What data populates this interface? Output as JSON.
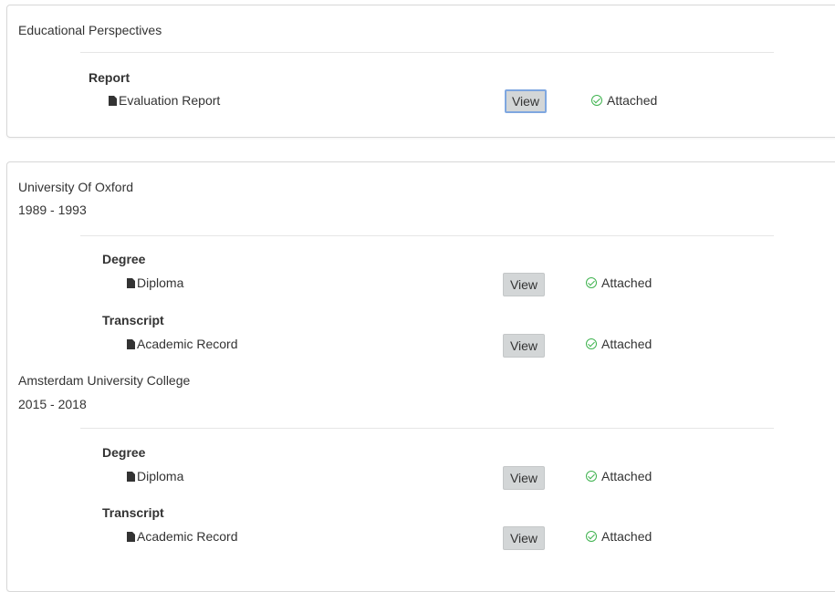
{
  "panel1": {
    "title": "Educational Perspectives",
    "section": {
      "heading": "Report",
      "document": "Evaluation Report",
      "view_label": "View",
      "status": "Attached"
    }
  },
  "institutions": [
    {
      "name": "University Of Oxford",
      "years": "1989 - 1993",
      "items": [
        {
          "heading": "Degree",
          "document": "Diploma",
          "view_label": "View",
          "status": "Attached"
        },
        {
          "heading": "Transcript",
          "document": "Academic Record",
          "view_label": "View",
          "status": "Attached"
        }
      ]
    },
    {
      "name": "Amsterdam University College",
      "years": "2015 - 2018",
      "items": [
        {
          "heading": "Degree",
          "document": "Diploma",
          "view_label": "View",
          "status": "Attached"
        },
        {
          "heading": "Transcript",
          "document": "Academic Record",
          "view_label": "View",
          "status": "Attached"
        }
      ]
    }
  ],
  "colors": {
    "status_ok": "#3fb34f",
    "button_bg": "#d3d6d7",
    "focus_border": "#7fa7e0"
  },
  "icons": {
    "document": "file-icon",
    "status": "check-circle-icon"
  }
}
